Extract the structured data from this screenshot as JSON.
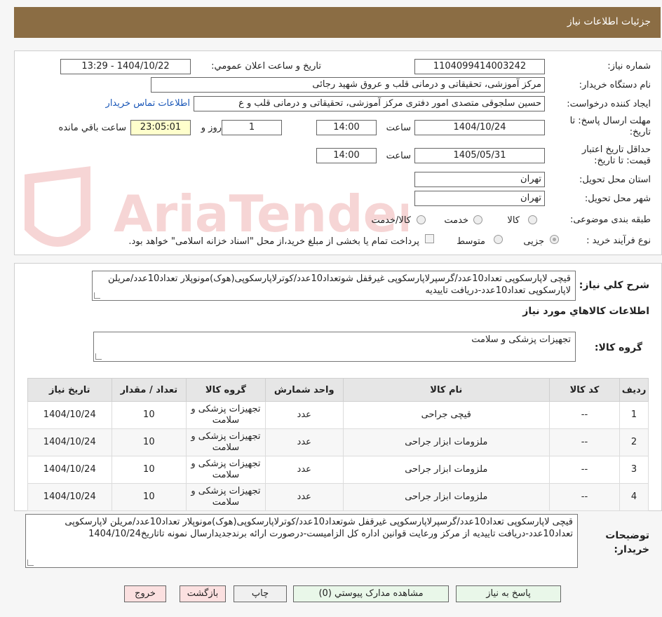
{
  "header": {
    "title": "جزئیات اطلاعات نیاز"
  },
  "form": {
    "need_number_label": "شماره نیاز:",
    "need_number": "1104099414003242",
    "announce_label": "تاریخ و ساعت اعلان عمومي:",
    "announce_value": "1404/10/22 - 13:29",
    "buyer_org_label": "نام دستگاه خریدار:",
    "buyer_org": "مرکز آموزشی، تحقیقاتی و درمانی قلب و عروق شهید رجائی",
    "requester_label": "ایجاد کننده درخواست:",
    "requester": "حسین سلجوقی متصدی امور دفتری مرکز آموزشی، تحقیقاتی و درمانی قلب و ع",
    "contact_link": "اطلاعات تماس خریدار",
    "deadline_label": "مهلت ارسال پاسخ: تا تاریخ:",
    "deadline_date": "1404/10/24",
    "time_label": "ساعت",
    "deadline_time": "14:00",
    "days_value": "1",
    "days_label": "روز و",
    "remaining_time": "23:05:01",
    "remaining_label": "ساعت باقي مانده",
    "validity_label": "حداقل تاریخ اعتبار قیمت: تا تاریخ:",
    "validity_date": "1405/05/31",
    "validity_time": "14:00",
    "province_label": "استان محل تحویل:",
    "province": "تهران",
    "city_label": "شهر محل تحویل:",
    "city": "تهران",
    "category_label": "طبقه بندی موضوعی:",
    "category_options": [
      "کالا",
      "خدمت",
      "کالا/خدمت"
    ],
    "process_label": "نوع فرآیند خرید :",
    "process_options": [
      "جزیی",
      "متوسط"
    ],
    "payment_note": "پرداخت تمام یا بخشی از مبلغ خرید،از محل \"اسناد خزانه اسلامی\" خواهد بود."
  },
  "summary": {
    "label": "شرح کلي نیاز:",
    "text": "قیچی لاپارسکوپی تعداد10عدد/گرسپرلاپارسکوپی غیرقفل شوتعداد10عدد/کوترلاپارسکوپی(هوک)مونوپلار تعداد10عدد/مریلن لاپارسکوپی تعداد10عدد-دریافت تاییدیه"
  },
  "goods": {
    "section_title": "اطلاعات کالاهاي مورد نیاز",
    "group_label": "گروه کالا:",
    "group_value": "تجهیزات پزشکی و سلامت",
    "columns": [
      "ردیف",
      "کد کالا",
      "نام کالا",
      "واحد شمارش",
      "گروه کالا",
      "تعداد / مقدار",
      "تاریخ نیاز"
    ],
    "rows": [
      {
        "row": "1",
        "code": "--",
        "name": "قیچی جراحی",
        "unit": "عدد",
        "group": "تجهیزات پزشکی و سلامت",
        "qty": "10",
        "date": "1404/10/24"
      },
      {
        "row": "2",
        "code": "--",
        "name": "ملزومات ابزار جراحی",
        "unit": "عدد",
        "group": "تجهیزات پزشکی و سلامت",
        "qty": "10",
        "date": "1404/10/24"
      },
      {
        "row": "3",
        "code": "--",
        "name": "ملزومات ابزار جراحی",
        "unit": "عدد",
        "group": "تجهیزات پزشکی و سلامت",
        "qty": "10",
        "date": "1404/10/24"
      },
      {
        "row": "4",
        "code": "--",
        "name": "ملزومات ابزار جراحی",
        "unit": "عدد",
        "group": "تجهیزات پزشکی و سلامت",
        "qty": "10",
        "date": "1404/10/24"
      }
    ]
  },
  "buyer_notes": {
    "label": "توضیحات خریدار:",
    "text": "قیچی لاپارسکوپی تعداد10عدد/گرسپرلاپارسکوپی غیرقفل شوتعداد10عدد/کوترلاپارسکوپی(هوک)مونوپلار تعداد10عدد/مریلن لاپارسکوپی تعداد10عدد-دریافت تاییدیه از مرکز ورعایت قوانین اداره کل الزامیست-درصورت ارائه برندجدیدارسال نمونه تاتاریخ1404/10/24"
  },
  "buttons": {
    "reply": "پاسخ به نیاز",
    "docs": "مشاهده مدارک پیوستي (0)",
    "print": "چاپ",
    "back": "بازگشت",
    "exit": "خروج"
  },
  "watermark": {
    "text": "AriaTender.neT"
  }
}
